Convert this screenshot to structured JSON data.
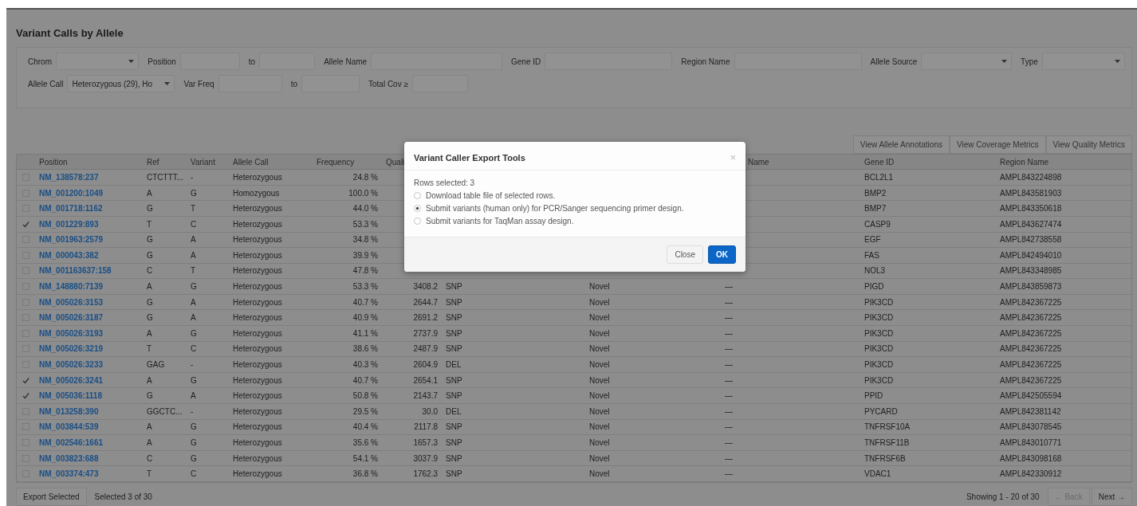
{
  "title": "Variant Calls by Allele",
  "filters": [
    [
      {
        "label": "Chrom",
        "kind": "select"
      },
      {
        "label": "Position",
        "kind": "input"
      },
      {
        "label": "to",
        "kind": "input"
      },
      {
        "label": "Allele Name",
        "kind": "input"
      },
      {
        "label": "Gene ID",
        "kind": "input"
      },
      {
        "label": "Region Name",
        "kind": "input"
      },
      {
        "label": "Allele Source",
        "kind": "select"
      },
      {
        "label": "Type",
        "kind": "select"
      }
    ],
    [
      {
        "label": "Allele Call",
        "kind": "select",
        "value": "Heterozygous (29), Ho"
      },
      {
        "label": "Var Freq",
        "kind": "input"
      },
      {
        "label": "to",
        "kind": "input"
      },
      {
        "label": "Total Cov ≥",
        "kind": "input"
      }
    ]
  ],
  "view_buttons": [
    "View Allele Annotations",
    "View Coverage Metrics",
    "View Quality Metrics"
  ],
  "table": {
    "columns": [
      "Position",
      "Ref",
      "Variant",
      "Allele Call",
      "Frequency",
      "Quali",
      "Name",
      "Gene ID",
      "Region Name"
    ],
    "rows": [
      {
        "checked": false,
        "position": "NM_138578:237",
        "ref": "CTCTTT...",
        "variant": "-",
        "allele_call": "Heterozygous",
        "frequency": "24.8 %",
        "gene_id": "BCL2L1",
        "region_name": "AMPL843224898"
      },
      {
        "checked": false,
        "position": "NM_001200:1049",
        "ref": "A",
        "variant": "G",
        "allele_call": "Homozygous",
        "frequency": "100.0 %",
        "gene_id": "BMP2",
        "region_name": "AMPL843581903"
      },
      {
        "checked": false,
        "position": "NM_001718:1162",
        "ref": "G",
        "variant": "T",
        "allele_call": "Heterozygous",
        "frequency": "44.0 %",
        "gene_id": "BMP7",
        "region_name": "AMPL843350618"
      },
      {
        "checked": true,
        "position": "NM_001229:893",
        "ref": "T",
        "variant": "C",
        "allele_call": "Heterozygous",
        "frequency": "53.3 %",
        "gene_id": "CASP9",
        "region_name": "AMPL843627474"
      },
      {
        "checked": false,
        "position": "NM_001963:2579",
        "ref": "G",
        "variant": "A",
        "allele_call": "Heterozygous",
        "frequency": "34.8 %",
        "gene_id": "EGF",
        "region_name": "AMPL842738558"
      },
      {
        "checked": false,
        "position": "NM_000043:382",
        "ref": "G",
        "variant": "A",
        "allele_call": "Heterozygous",
        "frequency": "39.9 %",
        "gene_id": "FAS",
        "region_name": "AMPL842494010"
      },
      {
        "checked": false,
        "position": "NM_001163637:158",
        "ref": "C",
        "variant": "T",
        "allele_call": "Heterozygous",
        "frequency": "47.8 %",
        "gene_id": "NOL3",
        "region_name": "AMPL843348985"
      },
      {
        "checked": false,
        "position": "NM_148880:7139",
        "ref": "A",
        "variant": "G",
        "allele_call": "Heterozygous",
        "frequency": "53.3 %",
        "quality": "3408.2",
        "type": "SNP",
        "allele_source": "Novel",
        "allele_name": "—",
        "gene_id": "PIGD",
        "region_name": "AMPL843859873"
      },
      {
        "checked": false,
        "position": "NM_005026:3153",
        "ref": "G",
        "variant": "A",
        "allele_call": "Heterozygous",
        "frequency": "40.7 %",
        "quality": "2644.7",
        "type": "SNP",
        "allele_source": "Novel",
        "allele_name": "—",
        "gene_id": "PIK3CD",
        "region_name": "AMPL842367225"
      },
      {
        "checked": false,
        "position": "NM_005026:3187",
        "ref": "G",
        "variant": "A",
        "allele_call": "Heterozygous",
        "frequency": "40.9 %",
        "quality": "2691.2",
        "type": "SNP",
        "allele_source": "Novel",
        "allele_name": "—",
        "gene_id": "PIK3CD",
        "region_name": "AMPL842367225"
      },
      {
        "checked": false,
        "position": "NM_005026:3193",
        "ref": "A",
        "variant": "G",
        "allele_call": "Heterozygous",
        "frequency": "41.1 %",
        "quality": "2737.9",
        "type": "SNP",
        "allele_source": "Novel",
        "allele_name": "—",
        "gene_id": "PIK3CD",
        "region_name": "AMPL842367225"
      },
      {
        "checked": false,
        "position": "NM_005026:3219",
        "ref": "T",
        "variant": "C",
        "allele_call": "Heterozygous",
        "frequency": "38.6 %",
        "quality": "2487.9",
        "type": "SNP",
        "allele_source": "Novel",
        "allele_name": "—",
        "gene_id": "PIK3CD",
        "region_name": "AMPL842367225"
      },
      {
        "checked": false,
        "position": "NM_005026:3233",
        "ref": "GAG",
        "variant": "-",
        "allele_call": "Heterozygous",
        "frequency": "40.3 %",
        "quality": "2604.9",
        "type": "DEL",
        "allele_source": "Novel",
        "allele_name": "—",
        "gene_id": "PIK3CD",
        "region_name": "AMPL842367225"
      },
      {
        "checked": true,
        "position": "NM_005026:3241",
        "ref": "A",
        "variant": "G",
        "allele_call": "Heterozygous",
        "frequency": "40.7 %",
        "quality": "2654.1",
        "type": "SNP",
        "allele_source": "Novel",
        "allele_name": "—",
        "gene_id": "PIK3CD",
        "region_name": "AMPL842367225"
      },
      {
        "checked": true,
        "position": "NM_005036:1118",
        "ref": "G",
        "variant": "A",
        "allele_call": "Heterozygous",
        "frequency": "50.8 %",
        "quality": "2143.7",
        "type": "SNP",
        "allele_source": "Novel",
        "allele_name": "—",
        "gene_id": "PPID",
        "region_name": "AMPL842505594"
      },
      {
        "checked": false,
        "position": "NM_013258:390",
        "ref": "GGCTC...",
        "variant": "-",
        "allele_call": "Heterozygous",
        "frequency": "29.5 %",
        "quality": "30.0",
        "type": "DEL",
        "allele_source": "Novel",
        "allele_name": "—",
        "gene_id": "PYCARD",
        "region_name": "AMPL842381142"
      },
      {
        "checked": false,
        "position": "NM_003844:539",
        "ref": "A",
        "variant": "G",
        "allele_call": "Heterozygous",
        "frequency": "40.4 %",
        "quality": "2117.8",
        "type": "SNP",
        "allele_source": "Novel",
        "allele_name": "—",
        "gene_id": "TNFRSF10A",
        "region_name": "AMPL843078545"
      },
      {
        "checked": false,
        "position": "NM_002546:1661",
        "ref": "A",
        "variant": "G",
        "allele_call": "Heterozygous",
        "frequency": "35.6 %",
        "quality": "1657.3",
        "type": "SNP",
        "allele_source": "Novel",
        "allele_name": "—",
        "gene_id": "TNFRSF11B",
        "region_name": "AMPL843010771"
      },
      {
        "checked": false,
        "position": "NM_003823:688",
        "ref": "C",
        "variant": "G",
        "allele_call": "Heterozygous",
        "frequency": "54.1 %",
        "quality": "3037.9",
        "type": "SNP",
        "allele_source": "Novel",
        "allele_name": "—",
        "gene_id": "TNFRSF6B",
        "region_name": "AMPL843098168"
      },
      {
        "checked": false,
        "position": "NM_003374:473",
        "ref": "T",
        "variant": "C",
        "allele_call": "Heterozygous",
        "frequency": "36.8 %",
        "quality": "1762.3",
        "type": "SNP",
        "allele_source": "Novel",
        "allele_name": "—",
        "gene_id": "VDAC1",
        "region_name": "AMPL842330912"
      }
    ]
  },
  "footer": {
    "export_button": "Export Selected",
    "selected_text": "Selected 3 of 30",
    "showing": "Showing 1 - 20 of 30",
    "back": {
      "label": "← Back",
      "disabled": true
    },
    "next": {
      "label": "Next →",
      "disabled": false
    }
  },
  "dialog": {
    "title": "Variant Caller Export Tools",
    "close_icon": "×",
    "rows_selected": "Rows selected: 3",
    "options": [
      {
        "label": "Download table file of selected rows.",
        "selected": false
      },
      {
        "label": "Submit variants (human only) for PCR/Sanger sequencing primer design.",
        "selected": true
      },
      {
        "label": "Submit variants for TaqMan assay design.",
        "selected": false
      }
    ],
    "buttons": [
      {
        "label": "Close",
        "kind": "default"
      },
      {
        "label": "OK",
        "kind": "primary"
      }
    ]
  }
}
